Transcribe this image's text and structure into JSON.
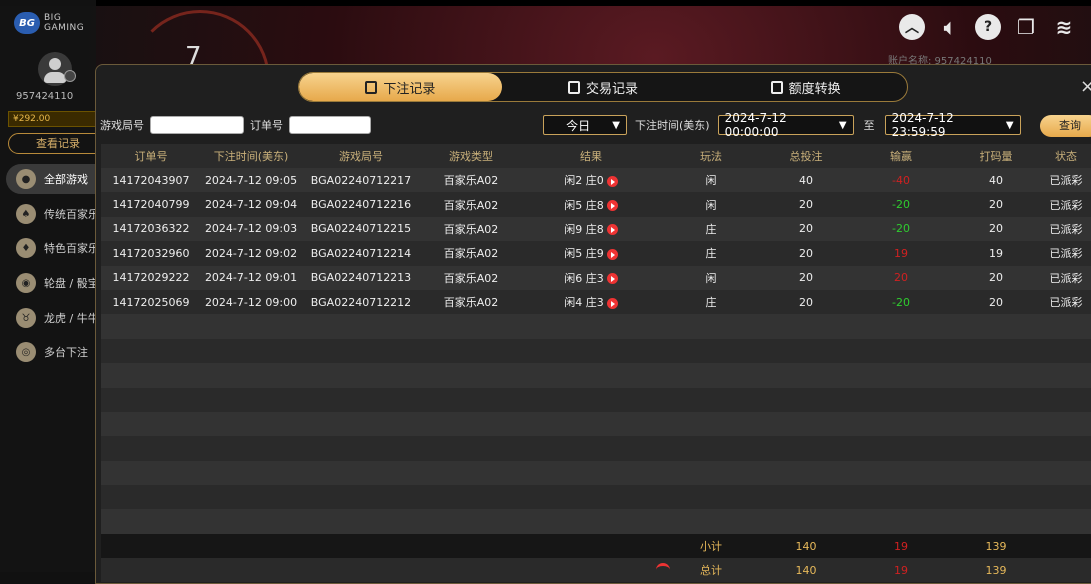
{
  "brand": {
    "logo_short": "BG",
    "logo_text_line1": "BIG",
    "logo_text_line2": "GAMING"
  },
  "user": {
    "id": "957424110",
    "balance": "¥292.00",
    "history_button": "查看记录"
  },
  "sidebar": {
    "items": [
      {
        "label": "全部游戏"
      },
      {
        "label": "传统百家乐"
      },
      {
        "label": "特色百家乐"
      },
      {
        "label": "轮盘 / 骰宝"
      },
      {
        "label": "龙虎 / 牛牛"
      },
      {
        "label": "多台下注"
      }
    ]
  },
  "stage": {
    "number": "7"
  },
  "account_strip": "账户名称: 957424110",
  "tabs": [
    {
      "label": "下注记录",
      "active": true
    },
    {
      "label": "交易记录",
      "active": false
    },
    {
      "label": "额度转换",
      "active": false
    }
  ],
  "filters": {
    "game_no_label": "游戏局号",
    "order_no_label": "订单号",
    "period_value": "今日",
    "bet_time_label": "下注时间(美东)",
    "start_time": "2024-7-12 00:00:00",
    "to_label": "至",
    "end_time": "2024-7-12 23:59:59",
    "query_button": "查询"
  },
  "table": {
    "headers": [
      "订单号",
      "下注时间(美东)",
      "游戏局号",
      "游戏类型",
      "结果",
      "玩法",
      "总投注",
      "输赢",
      "打码量",
      "状态"
    ],
    "rows": [
      {
        "order": "14172043907",
        "time": "2024-7-12 09:05",
        "game_no": "BGA02240712217",
        "type": "百家乐A02",
        "result": "闲2 庄0",
        "play": "闲",
        "bet": "40",
        "win": "-40",
        "win_color": "red",
        "valid": "40",
        "status": "已派彩"
      },
      {
        "order": "14172040799",
        "time": "2024-7-12 09:04",
        "game_no": "BGA02240712216",
        "type": "百家乐A02",
        "result": "闲5 庄8",
        "play": "闲",
        "bet": "20",
        "win": "-20",
        "win_color": "green",
        "valid": "20",
        "status": "已派彩"
      },
      {
        "order": "14172036322",
        "time": "2024-7-12 09:03",
        "game_no": "BGA02240712215",
        "type": "百家乐A02",
        "result": "闲9 庄8",
        "play": "庄",
        "bet": "20",
        "win": "-20",
        "win_color": "green",
        "valid": "20",
        "status": "已派彩"
      },
      {
        "order": "14172032960",
        "time": "2024-7-12 09:02",
        "game_no": "BGA02240712214",
        "type": "百家乐A02",
        "result": "闲5 庄9",
        "play": "庄",
        "bet": "20",
        "win": "19",
        "win_color": "red",
        "valid": "19",
        "status": "已派彩"
      },
      {
        "order": "14172029222",
        "time": "2024-7-12 09:01",
        "game_no": "BGA02240712213",
        "type": "百家乐A02",
        "result": "闲6 庄3",
        "play": "闲",
        "bet": "20",
        "win": "20",
        "win_color": "red",
        "valid": "20",
        "status": "已派彩"
      },
      {
        "order": "14172025069",
        "time": "2024-7-12 09:00",
        "game_no": "BGA02240712212",
        "type": "百家乐A02",
        "result": "闲4 庄3",
        "play": "庄",
        "bet": "20",
        "win": "-20",
        "win_color": "green",
        "valid": "20",
        "status": "已派彩"
      }
    ]
  },
  "subtotal": {
    "label": "小计",
    "bet": "140",
    "win": "19",
    "valid": "139"
  },
  "total": {
    "label": "总计",
    "bet": "140",
    "win": "19",
    "valid": "139"
  },
  "colors": {
    "accent": "#e7a94b",
    "loss": "#d02121",
    "gain": "#2fcc2f"
  }
}
